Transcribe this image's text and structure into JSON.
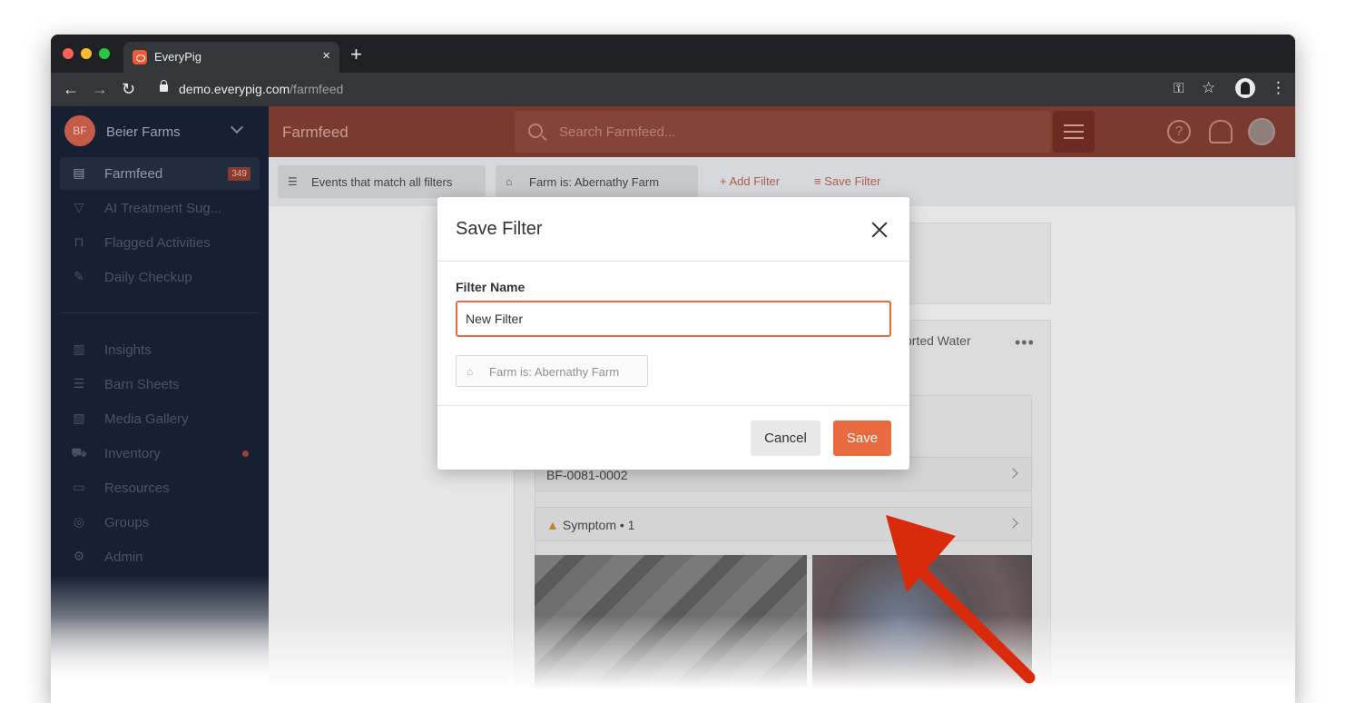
{
  "browser": {
    "tab_title": "EveryPig",
    "tab_close": "×",
    "new_tab": "+",
    "url_host": "demo.everypig.com",
    "url_path": "/farmfeed"
  },
  "sidebar": {
    "farm_initials": "BF",
    "farm_name": "Beier Farms",
    "items": [
      {
        "label": "Farmfeed",
        "icon": "newspaper-icon",
        "badge": "349"
      },
      {
        "label": "AI Treatment Sug...",
        "icon": "funnel-icon"
      },
      {
        "label": "Flagged Activities",
        "icon": "bookmark-icon"
      },
      {
        "label": "Daily Checkup",
        "icon": "edit-icon"
      },
      {
        "label": "Insights",
        "icon": "bar-chart-icon"
      },
      {
        "label": "Barn Sheets",
        "icon": "list-icon"
      },
      {
        "label": "Media Gallery",
        "icon": "image-icon"
      },
      {
        "label": "Inventory",
        "icon": "truck-icon"
      },
      {
        "label": "Resources",
        "icon": "folder-icon"
      },
      {
        "label": "Groups",
        "icon": "pig-icon"
      },
      {
        "label": "Admin",
        "icon": "gear-icon"
      }
    ]
  },
  "header": {
    "title": "Farmfeed",
    "search_placeholder": "Search Farmfeed..."
  },
  "filterbar": {
    "match_label": "Events that match all filters",
    "farm_filter": "Farm is: Abernathy Farm",
    "add_filter": "+ Add Filter",
    "save_filter": "Save Filter"
  },
  "feed": {
    "card_text": "orted Water",
    "more": "•••",
    "row1": "BF-0081-0002",
    "row2": "Symptom • 1"
  },
  "modal": {
    "title": "Save Filter",
    "field_label": "Filter Name",
    "field_value": "New Filter",
    "filter_chip": "Farm is: Abernathy Farm",
    "cancel": "Cancel",
    "save": "Save"
  },
  "colors": {
    "accent": "#e86a3e",
    "sidebar_bg": "#172032",
    "annotation_arrow": "#d92b0c"
  }
}
